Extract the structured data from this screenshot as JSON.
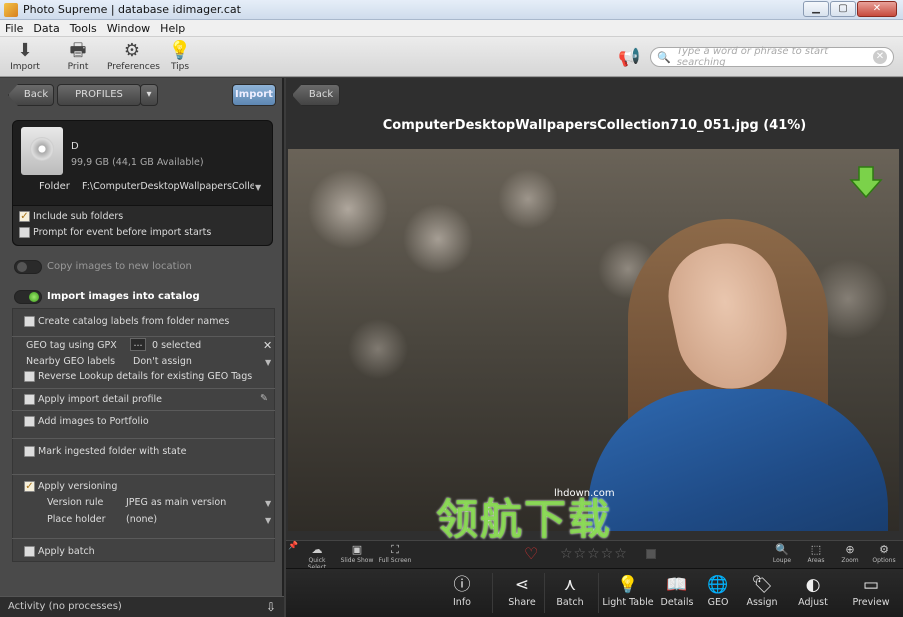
{
  "window": {
    "title": "Photo Supreme | database idimager.cat"
  },
  "menu": [
    "File",
    "Data",
    "Tools",
    "Window",
    "Help"
  ],
  "toolbar": {
    "import": "Import",
    "print": "Print",
    "preferences": "Preferences",
    "tips": "Tips"
  },
  "search": {
    "placeholder": "Type a word or phrase to start searching"
  },
  "left": {
    "back": "Back",
    "profiles": "PROFILES",
    "import": "Import",
    "drive": {
      "name": "D",
      "size": "99,9 GB (44,1 GB Available)",
      "folder_label": "Folder",
      "folder_value": "F:\\ComputerDesktopWallpapersCollection"
    },
    "include_sub": "Include sub folders",
    "prompt_event": "Prompt for event before import starts",
    "copy_images": "Copy images to new location",
    "import_catalog": "Import images into catalog",
    "create_labels": "Create catalog labels from folder names",
    "geo_tag": "GEO tag using GPX",
    "geo_button": "...",
    "geo_selected": "0 selected",
    "nearby_geo": "Nearby GEO labels",
    "nearby_value": "Don't assign",
    "reverse_lookup": "Reverse Lookup details for existing GEO Tags",
    "apply_profile": "Apply import detail profile",
    "add_portfolio": "Add images to Portfolio",
    "mark_folder": "Mark ingested folder with state",
    "apply_versioning": "Apply versioning",
    "version_rule": "Version rule",
    "version_rule_value": "JPEG as main version",
    "place_holder": "Place holder",
    "place_holder_value": "(none)",
    "apply_batch": "Apply batch",
    "activity": "Activity (no processes)"
  },
  "right": {
    "back": "Back",
    "image_title": "ComputerDesktopWallpapersCollection710_051.jpg (41%)",
    "viewbar": {
      "quick_select": "Quick Select",
      "slide_show": "Slide Show",
      "full_screen": "Full Screen",
      "loupe": "Loupe",
      "areas": "Areas",
      "zoom": "Zoom",
      "options": "Options"
    },
    "actions": {
      "info": "Info",
      "share": "Share",
      "batch": "Batch",
      "light_table": "Light Table",
      "details": "Details",
      "geo": "GEO",
      "assign": "Assign",
      "adjust": "Adjust",
      "preview": "Preview"
    }
  },
  "watermark": {
    "text": "领航下载",
    "site": "lhdown.com"
  }
}
